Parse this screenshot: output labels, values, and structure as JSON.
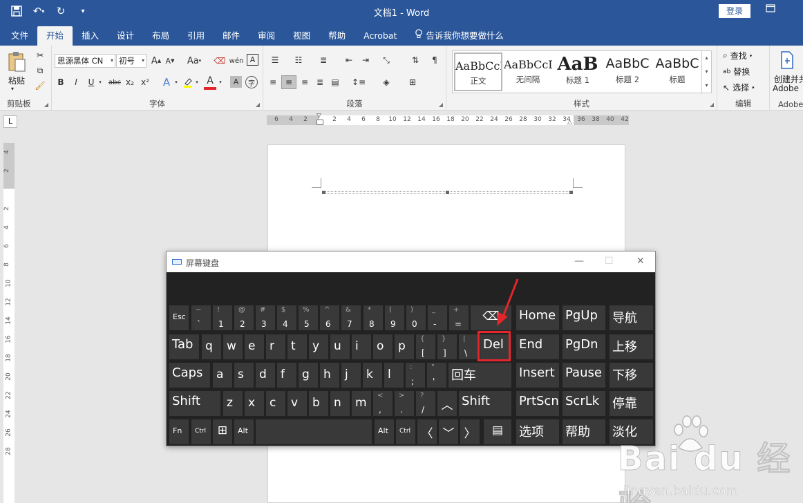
{
  "titlebar": {
    "title": "文档1  -  Word",
    "login": "登录",
    "restore_icon": "restore-window-icon",
    "close_icon": "close-window-icon"
  },
  "tabs": [
    {
      "label": "文件"
    },
    {
      "label": "开始"
    },
    {
      "label": "插入"
    },
    {
      "label": "设计"
    },
    {
      "label": "布局"
    },
    {
      "label": "引用"
    },
    {
      "label": "邮件"
    },
    {
      "label": "审阅"
    },
    {
      "label": "视图"
    },
    {
      "label": "帮助"
    },
    {
      "label": "Acrobat"
    }
  ],
  "tell_me": "告诉我你想要做什么",
  "ribbon": {
    "clipboard": {
      "paste": "粘贴",
      "label": "剪贴板"
    },
    "font": {
      "name": "思源黑体 CN",
      "size": "初号",
      "label": "字体",
      "grow": "A",
      "shrink": "A",
      "case": "Aa",
      "bold": "B",
      "italic": "I",
      "underline": "U",
      "strike": "abc",
      "sub": "x₂",
      "sup": "x²",
      "color_a": "A"
    },
    "paragraph": {
      "label": "段落"
    },
    "styles": {
      "label": "样式",
      "items": [
        {
          "preview": "AaBbCcDc",
          "name": "正文"
        },
        {
          "preview": "AaBbCcDc",
          "name": "无间隔"
        },
        {
          "preview": "AaB",
          "name": "标题 1"
        },
        {
          "preview": "AaBbC",
          "name": "标题 2"
        },
        {
          "preview": "AaBbC",
          "name": "标题"
        }
      ]
    },
    "editing": {
      "find": "查找",
      "replace": "替换",
      "select": "选择",
      "label": "编辑"
    },
    "adobe": {
      "create": "创建并共",
      "sub": "Adobe",
      "label": "Adobe"
    }
  },
  "ruler": {
    "corner": "L",
    "h_ticks": [
      "6",
      "4",
      "2",
      "2",
      "4",
      "6",
      "8",
      "10",
      "12",
      "14",
      "16",
      "18",
      "20",
      "22",
      "24",
      "26",
      "28",
      "30",
      "32",
      "34",
      "36",
      "38",
      "40",
      "42"
    ],
    "v_ticks": [
      "4",
      "2",
      "2",
      "4",
      "6",
      "8",
      "10",
      "12",
      "14",
      "16",
      "18",
      "20",
      "22",
      "24",
      "26",
      "28"
    ]
  },
  "osk": {
    "title": "屏幕键盘",
    "rows": {
      "r1": [
        {
          "main": "Esc"
        },
        {
          "up": "~",
          "lo": "`"
        },
        {
          "up": "!",
          "lo": "1"
        },
        {
          "up": "@",
          "lo": "2"
        },
        {
          "up": "#",
          "lo": "3"
        },
        {
          "up": "$",
          "lo": "4"
        },
        {
          "up": "%",
          "lo": "5"
        },
        {
          "up": "^",
          "lo": "6"
        },
        {
          "up": "&",
          "lo": "7"
        },
        {
          "up": "*",
          "lo": "8"
        },
        {
          "up": "(",
          "lo": "9"
        },
        {
          "up": ")",
          "lo": "0"
        },
        {
          "up": "_",
          "lo": "-"
        },
        {
          "up": "+",
          "lo": "="
        }
      ],
      "r2": [
        "Tab",
        "q",
        "w",
        "e",
        "r",
        "t",
        "y",
        "u",
        "i",
        "o",
        "p"
      ],
      "r2sym": [
        {
          "up": "{",
          "lo": "["
        },
        {
          "up": "}",
          "lo": "]"
        },
        {
          "up": "|",
          "lo": "\\"
        }
      ],
      "r3": [
        "Caps",
        "a",
        "s",
        "d",
        "f",
        "g",
        "h",
        "j",
        "k",
        "l"
      ],
      "r3sym": [
        {
          "up": ":",
          "lo": ";"
        },
        {
          "up": "\"",
          "lo": "'"
        }
      ],
      "r4": [
        "Shift",
        "z",
        "x",
        "c",
        "v",
        "b",
        "n",
        "m"
      ],
      "r4sym": [
        {
          "up": "<",
          "lo": ","
        },
        {
          "up": ">",
          "lo": "."
        },
        {
          "up": "?",
          "lo": "/"
        }
      ]
    },
    "keys": {
      "del": "Del",
      "enter": "回车",
      "shift_r": "Shift",
      "fn": "Fn",
      "ctrl": "Ctrl",
      "alt": "Alt",
      "home": "Home",
      "pgup": "PgUp",
      "nav": "导航",
      "end": "End",
      "pgdn": "PgDn",
      "moveup": "上移",
      "insert": "Insert",
      "pause": "Pause",
      "movedown": "下移",
      "prtscn": "PrtScn",
      "scrlk": "ScrLk",
      "dock": "停靠",
      "options": "选项",
      "help": "帮助",
      "fade": "淡化"
    }
  },
  "colors": {
    "word_blue": "#2b579a",
    "highlight_red": "#e3262c",
    "osk_key": "#393939"
  }
}
